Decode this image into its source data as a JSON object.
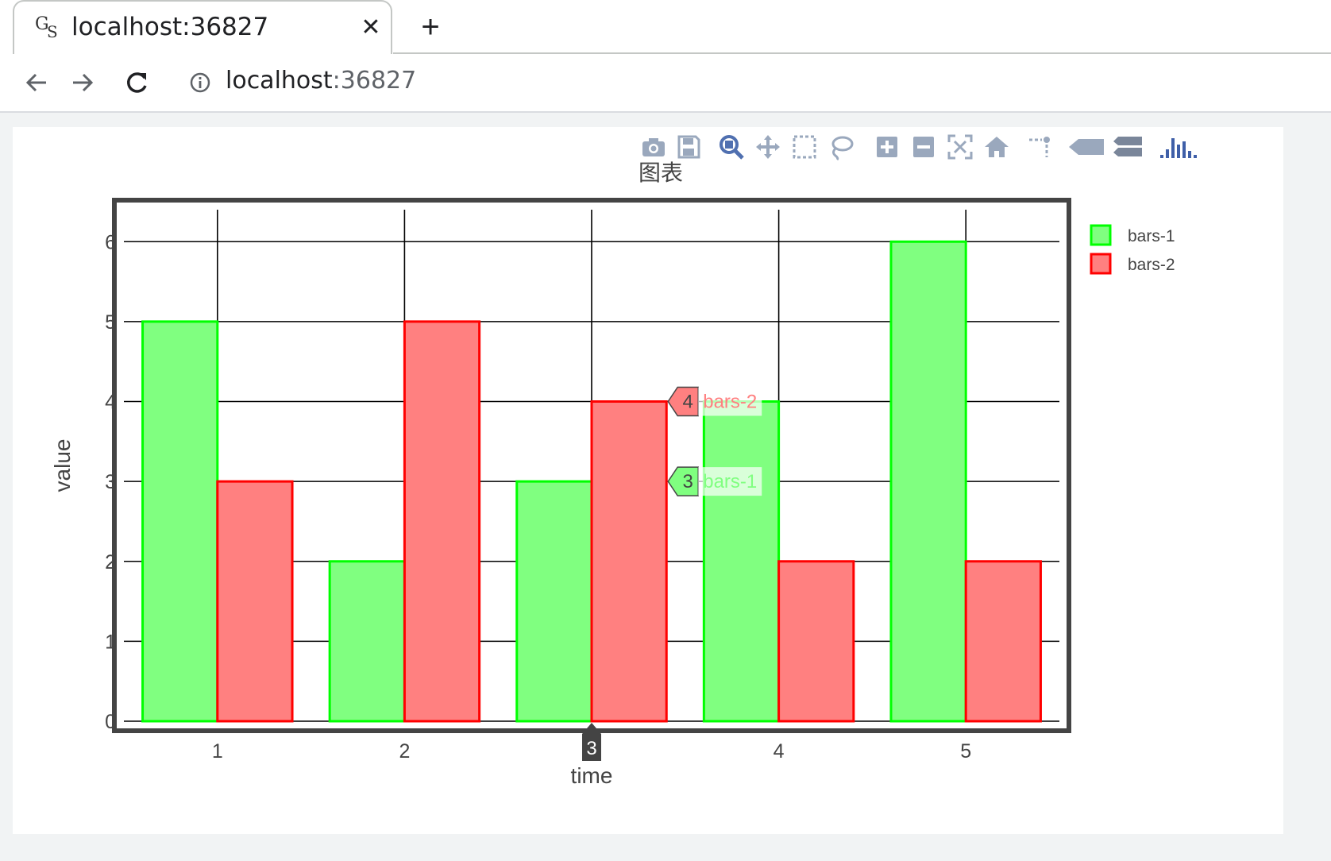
{
  "browser": {
    "tab_title": "localhost:36827",
    "favicon_text_top": "G",
    "favicon_text_bottom": "S",
    "close_symbol": "✕",
    "new_tab_symbol": "+",
    "address_host": "localhost",
    "address_port": ":36827"
  },
  "modebar": {
    "icons": [
      "camera-icon",
      "save-icon",
      "zoom-icon",
      "pan-icon",
      "box-select-icon",
      "lasso-select-icon",
      "zoom-in-icon",
      "zoom-out-icon",
      "autoscale-icon",
      "reset-axes-icon",
      "spike-lines-icon",
      "hover-closest-icon",
      "hover-compare-icon",
      "plotly-logo-icon"
    ]
  },
  "chart_data": {
    "type": "bar",
    "title": "图表",
    "xlabel": "time",
    "ylabel": "value",
    "categories": [
      1,
      2,
      3,
      4,
      5
    ],
    "tick_labels_x": [
      "1",
      "2",
      "",
      "4",
      "5"
    ],
    "tick_labels_y": [
      "0",
      "1",
      "2",
      "3",
      "4",
      "5",
      "6"
    ],
    "ylim": [
      0,
      6.4
    ],
    "xlim": [
      0.5,
      5.5
    ],
    "grid": true,
    "legend_position": "top-right",
    "series": [
      {
        "name": "bars-1",
        "values": [
          5,
          2,
          3,
          4,
          6
        ],
        "fill": "#80ff80",
        "line": "#00ff00"
      },
      {
        "name": "bars-2",
        "values": [
          3,
          5,
          4,
          2,
          2
        ],
        "fill": "#ff8080",
        "line": "#ff0000"
      }
    ],
    "hover": {
      "x_label": "3",
      "items": [
        {
          "series": "bars-2",
          "value": "4"
        },
        {
          "series": "bars-1",
          "value": "3"
        }
      ]
    }
  },
  "colors": {
    "axis_frame": "#444444",
    "grid": "#000000",
    "spike_label_bg": "#444444",
    "modebar_icon": "#9aa8bd",
    "modebar_active": "#5070b0"
  }
}
